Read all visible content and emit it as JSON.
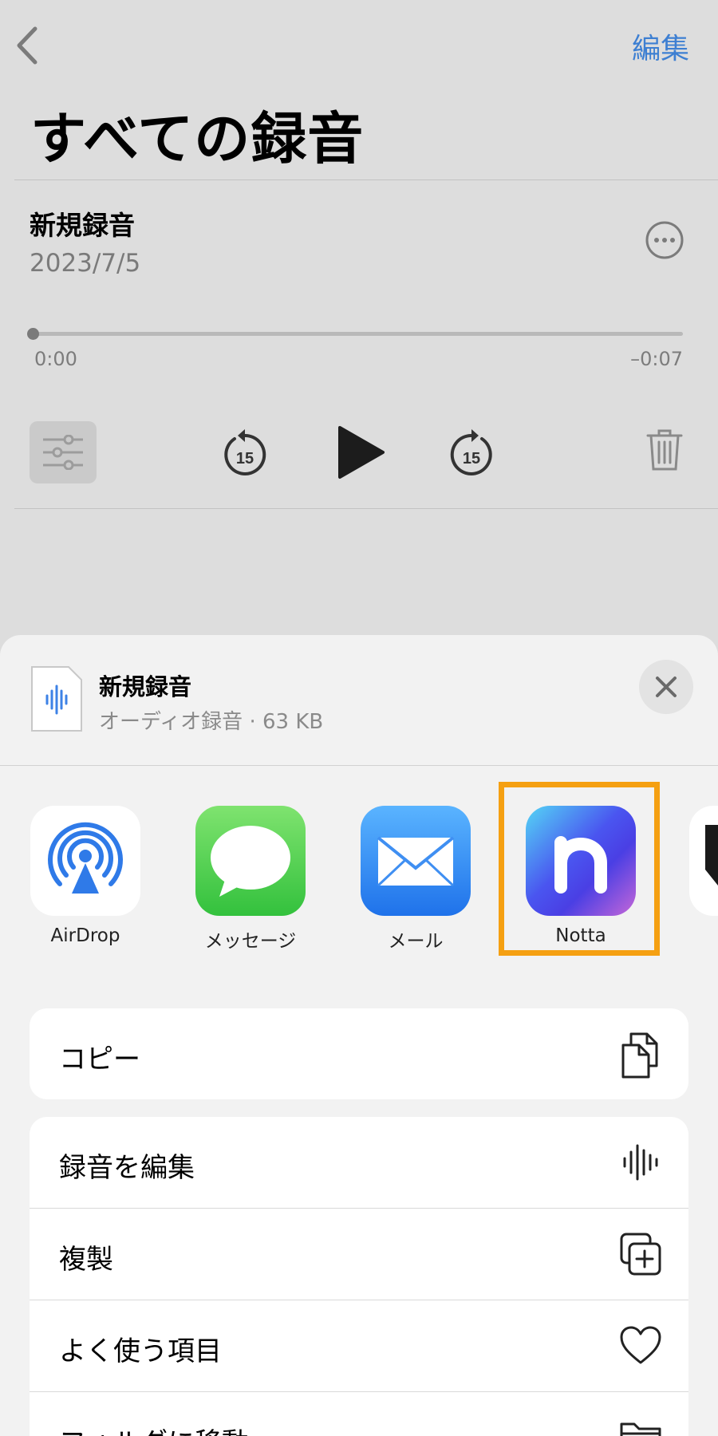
{
  "nav": {
    "edit_label": "編集"
  },
  "page": {
    "title": "すべての録音"
  },
  "recording": {
    "title": "新規録音",
    "date": "2023/7/5",
    "time_elapsed": "0:00",
    "time_remaining": "–0:07",
    "progress": 0.0,
    "skip_seconds": "15"
  },
  "share_sheet": {
    "file_name": "新規録音",
    "file_info": "オーディオ録音 · 63 KB",
    "apps": [
      {
        "label": "AirDrop",
        "icon": "airdrop-icon"
      },
      {
        "label": "メッセージ",
        "icon": "messages-icon"
      },
      {
        "label": "メール",
        "icon": "mail-icon"
      },
      {
        "label": "Notta",
        "icon": "notta-icon",
        "highlighted": true
      }
    ],
    "copy_action": {
      "label": "コピー",
      "icon": "copy-icon"
    },
    "actions": [
      {
        "label": "録音を編集",
        "icon": "waveform-icon"
      },
      {
        "label": "複製",
        "icon": "duplicate-icon"
      },
      {
        "label": "よく使う項目",
        "icon": "heart-icon"
      },
      {
        "label": "フォルダに移動",
        "icon": "folder-icon"
      }
    ],
    "highlight_color": "#f5a012"
  },
  "colors": {
    "accent": "#3d7fd2",
    "background": "#dddddd",
    "sheet": "#f2f2f2"
  }
}
